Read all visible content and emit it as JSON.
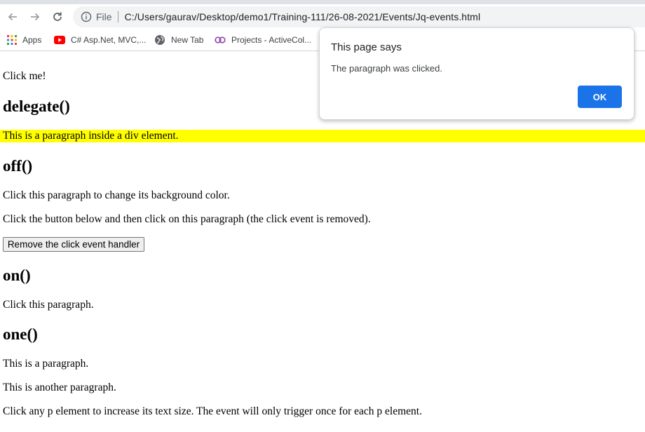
{
  "browser": {
    "omnibox": {
      "scheme_label": "File",
      "url": "C:/Users/gaurav/Desktop/demo1/Training-111/26-08-2021/Events/Jq-events.html"
    },
    "bookmarks": [
      {
        "label": "Apps",
        "icon": "apps-grid-icon"
      },
      {
        "label": "C# Asp.Net, MVC,...",
        "icon": "youtube-icon"
      },
      {
        "label": "New Tab",
        "icon": "globe-icon"
      },
      {
        "label": "Projects - ActiveCol...",
        "icon": "activecollab-icon"
      }
    ]
  },
  "page": {
    "click_me": "Click me!",
    "delegate_heading": "delegate()",
    "delegate_paragraph": "This is a paragraph inside a div element.",
    "off_heading": "off()",
    "off_paragraph_1": "Click this paragraph to change its background color.",
    "off_paragraph_2": "Click the button below and then click on this paragraph (the click event is removed).",
    "off_button": "Remove the click event handler",
    "on_heading": "on()",
    "on_paragraph": "Click this paragraph.",
    "one_heading": "one()",
    "one_paragraph_1": "This is a paragraph.",
    "one_paragraph_2": "This is another paragraph.",
    "one_paragraph_3": "Click any p element to increase its text size. The event will only trigger once for each p element."
  },
  "dialog": {
    "title": "This page says",
    "message": "The paragraph was clicked.",
    "ok_label": "OK"
  },
  "colors": {
    "highlight": "#ffff00",
    "ok_button": "#1a73e8"
  }
}
